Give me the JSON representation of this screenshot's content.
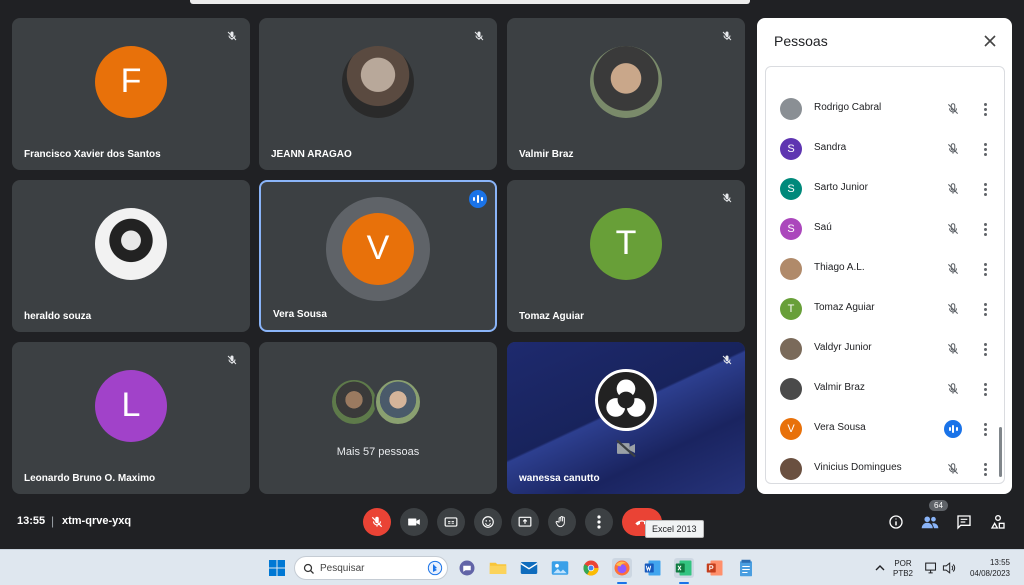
{
  "meeting": {
    "time": "13:55",
    "separator": "|",
    "code": "xtm-qrve-yxq"
  },
  "tiles": [
    {
      "name": "Francisco Xavier dos Santos",
      "initial": "F",
      "color": "#e8710a"
    },
    {
      "name": "JEANN ARAGAO"
    },
    {
      "name": "Valmir Braz"
    },
    {
      "name": "heraldo souza"
    },
    {
      "name": "Vera Sousa",
      "initial": "V",
      "color": "#e8710a"
    },
    {
      "name": "Tomaz Aguiar",
      "initial": "T",
      "color": "#689f38"
    },
    {
      "name": "Leonardo Bruno O. Maximo",
      "initial": "L",
      "color": "#a142c9"
    },
    {
      "more_label": "Mais 57 pessoas"
    },
    {
      "name": "wanessa canutto"
    }
  ],
  "people_panel": {
    "title": "Pessoas",
    "participants": [
      {
        "name": "Rodrigo Cabral",
        "initial": "",
        "color": "#8a8f94",
        "status": "muted"
      },
      {
        "name": "Sandra",
        "initial": "S",
        "color": "#5e35b1",
        "status": "muted"
      },
      {
        "name": "Sarto Junior",
        "initial": "S",
        "color": "#00897b",
        "status": "muted"
      },
      {
        "name": "Saú",
        "initial": "S",
        "color": "#ab47bc",
        "status": "muted"
      },
      {
        "name": "Thiago A.L.",
        "initial": "",
        "color": "#b08a6a",
        "status": "muted"
      },
      {
        "name": "Tomaz Aguiar",
        "initial": "T",
        "color": "#689f38",
        "status": "muted"
      },
      {
        "name": "Valdyr Junior",
        "initial": "",
        "color": "#7a6a5a",
        "status": "muted"
      },
      {
        "name": "Valmir Braz",
        "initial": "",
        "color": "#4a4a4a",
        "status": "muted"
      },
      {
        "name": "Vera Sousa",
        "initial": "V",
        "color": "#e8710a",
        "status": "speaking"
      },
      {
        "name": "Vinicius Domingues",
        "initial": "",
        "color": "#6a5040",
        "status": "muted"
      }
    ]
  },
  "controls": {
    "tooltip": "Excel 2013",
    "people_count": "64"
  },
  "taskbar": {
    "search_placeholder": "Pesquisar",
    "lang_line1": "POR",
    "lang_line2": "PTB2",
    "clock_time": "13:55",
    "clock_date": "04/08/2023"
  }
}
